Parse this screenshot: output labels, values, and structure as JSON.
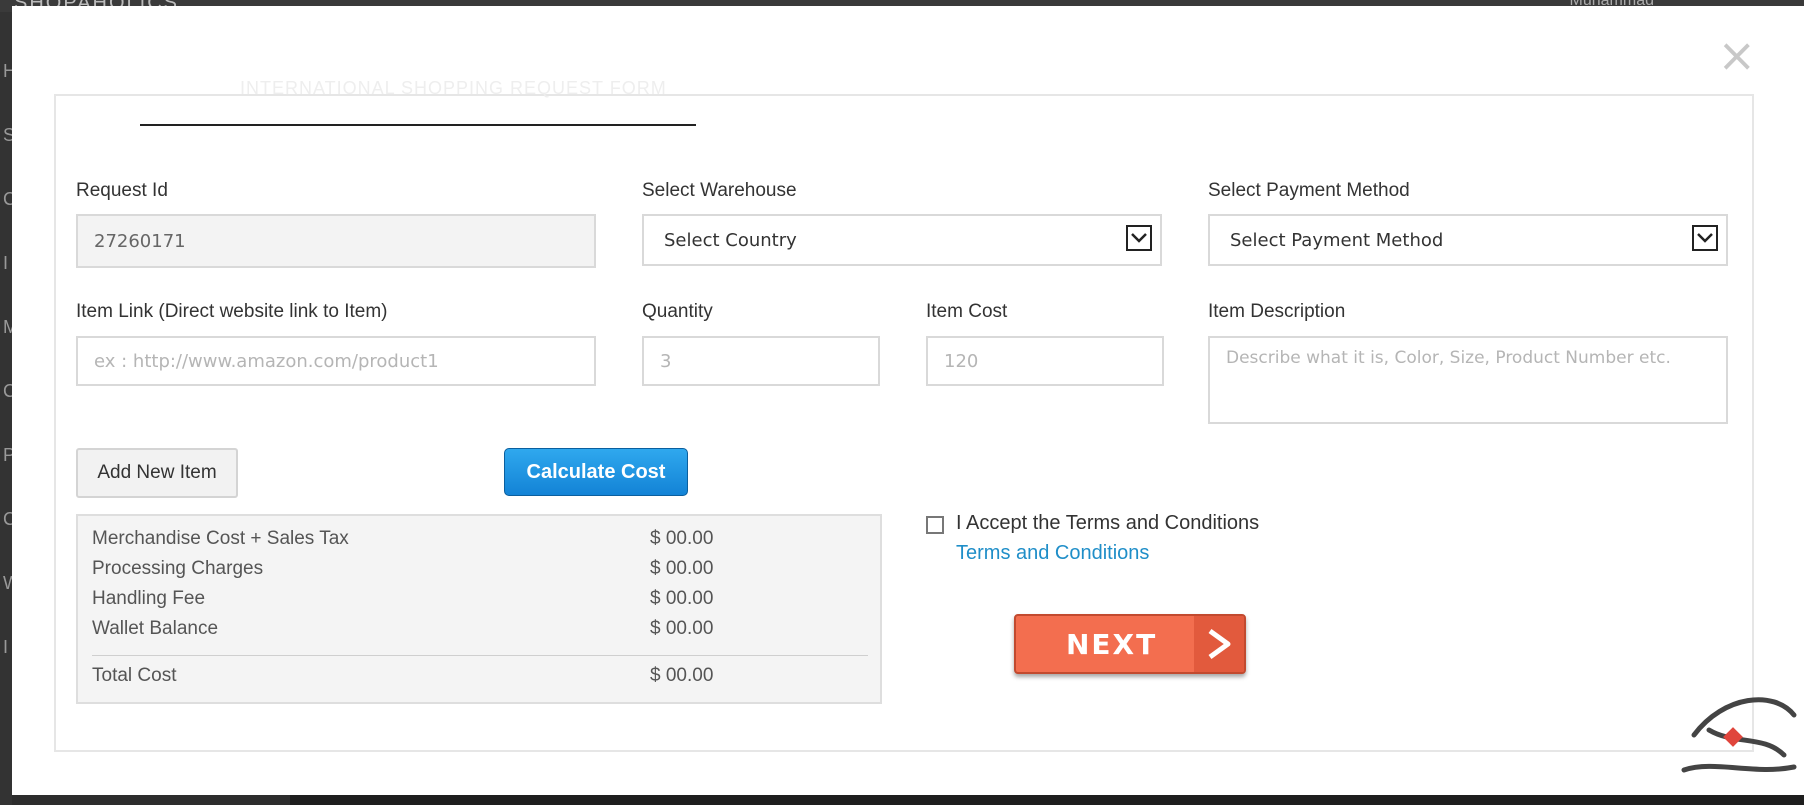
{
  "background": {
    "brand": "SHOPAHOLICS",
    "user_name": "Muhammad",
    "sidebar_letters": [
      "H",
      "S",
      "C",
      "I",
      "M",
      "C",
      "P",
      "C",
      "W",
      "I"
    ]
  },
  "modal": {
    "close_glyph": "×",
    "heading": "INTERNATIONAL SHOPPING REQUEST FORM"
  },
  "form": {
    "request_id": {
      "label": "Request Id",
      "value": "27260171"
    },
    "warehouse": {
      "label": "Select Warehouse",
      "selected": "Select Country"
    },
    "payment": {
      "label": "Select Payment Method",
      "selected": "Select Payment Method"
    },
    "item_link": {
      "label": "Item Link (Direct website link to Item)",
      "placeholder": "ex : http://www.amazon.com/product1"
    },
    "quantity": {
      "label": "Quantity",
      "placeholder": "3"
    },
    "item_cost": {
      "label": "Item Cost",
      "placeholder": "120"
    },
    "item_description": {
      "label": "Item Description",
      "placeholder": "Describe what it is, Color, Size, Product Number etc."
    }
  },
  "buttons": {
    "add_item": "Add New Item",
    "calculate": "Calculate Cost",
    "next": "NEXT",
    "next_arrow": ">"
  },
  "summary": {
    "rows": [
      {
        "label": "Merchandise Cost + Sales Tax",
        "amount": "$ 00.00"
      },
      {
        "label": "Processing Charges",
        "amount": "$ 00.00"
      },
      {
        "label": "Handling Fee",
        "amount": "$ 00.00"
      },
      {
        "label": "Wallet Balance",
        "amount": "$ 00.00"
      }
    ],
    "total": {
      "label": "Total Cost",
      "amount": "$ 00.00"
    }
  },
  "terms": {
    "checked": false,
    "label": "I Accept the Terms and Conditions",
    "link": "Terms and Conditions"
  },
  "colors": {
    "accent_blue": "#1383d6",
    "next_orange": "#f36e4f",
    "link": "#1f8ec8"
  },
  "icons": {
    "close": "close-icon",
    "select_arrow": "chevron-down-icon",
    "next_arrow": "arrow-right-icon"
  }
}
